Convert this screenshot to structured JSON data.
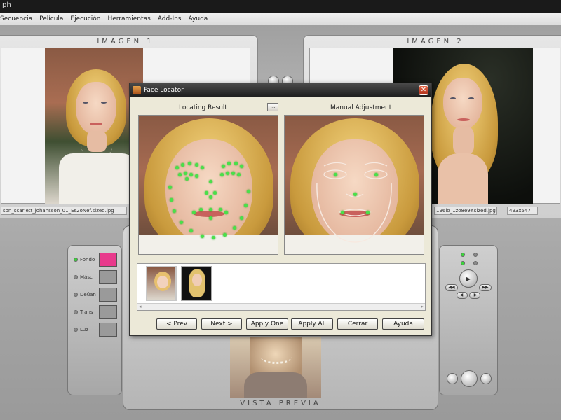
{
  "window": {
    "title": "ph"
  },
  "menu": [
    "Secuencia",
    "Película",
    "Ejecución",
    "Herramientas",
    "Add-Ins",
    "Ayuda"
  ],
  "panel1": {
    "title": "IMAGEN 1",
    "filename": "son_scarlett_johansson_01_Es2oNef.sized.jpg"
  },
  "panel2": {
    "title": "IMAGEN 2",
    "filename": "196lo_1zo8e9Y.sized.jpg",
    "size": "493x547"
  },
  "layers": [
    {
      "label": "Fondo",
      "active": true
    },
    {
      "label": "Másc",
      "active": false
    },
    {
      "label": "Deúan",
      "active": false
    },
    {
      "label": "Trans",
      "active": false
    },
    {
      "label": "Luz",
      "active": false
    }
  ],
  "preview": {
    "title": "VISTA PREVIA"
  },
  "dialog": {
    "title": "Face Locator",
    "locating_label": "Locating Result",
    "manual_label": "Manual Adjustment",
    "dots": "...",
    "buttons": {
      "prev": "< Prev",
      "next": "Next >",
      "apply_one": "Apply One",
      "apply_all": "Apply All",
      "close": "Cerrar",
      "help": "Ayuda"
    }
  },
  "colors": {
    "accent_pink": "#e83a8c",
    "feature_point": "#49e04a",
    "layer_on": "#3cd43c"
  }
}
